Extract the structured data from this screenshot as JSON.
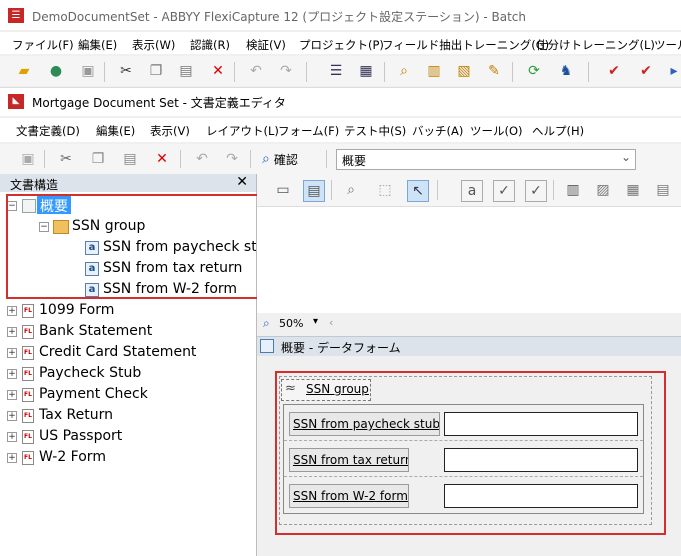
{
  "outer": {
    "title": "DemoDocumentSet - ABBYY FlexiCapture 12 (プロジェクト設定ステーション) - Batch",
    "menu": [
      "ファイル(F)",
      "編集(E)",
      "表示(W)",
      "認識(R)",
      "検証(V)",
      "プロジェクト(P)",
      "フィールド抽出トレーニング(G)",
      "仕分けトレーニング(L)",
      "ツール"
    ]
  },
  "inner": {
    "title": "Mortgage Document Set - 文書定義エディタ",
    "menu": [
      "文書定義(D)",
      "編集(E)",
      "表示(V)",
      "レイアウト(L)",
      "フォーム(F)",
      "テスト中(S)",
      "バッチ(A)",
      "ツール(O)",
      "ヘルプ(H)"
    ],
    "confirm_label": "確認",
    "section_dropdown": "概要"
  },
  "tree": {
    "header": "文書構造",
    "root": "概要",
    "group": "SSN group",
    "fields": [
      "SSN from paycheck stub",
      "SSN from tax return",
      "SSN from W-2 form"
    ],
    "sections": [
      "1099 Form",
      "Bank Statement",
      "Credit Card Statement",
      "Paycheck Stub",
      "Payment Check",
      "Tax Return",
      "US Passport",
      "W-2 Form"
    ]
  },
  "editor": {
    "zoom": "50%",
    "form_title": "概要 - データフォーム",
    "group_label": "SSN group",
    "field_labels": [
      "SSN from paycheck stub",
      "SSN from tax return",
      "SSN from W-2 form"
    ],
    "field_values": [
      "",
      "",
      ""
    ]
  },
  "colors": {
    "highlight": "#d32f2f",
    "selection": "#3399ff",
    "brand": "#c62828"
  },
  "icons": {
    "outer_toolbar": [
      "open-folder-icon",
      "open-icon",
      "save-icon",
      "cut-icon",
      "copy-icon",
      "paste-icon",
      "delete-icon",
      "undo-icon",
      "redo-icon",
      "list-view-icon",
      "grid-view-icon",
      "preview-icon",
      "document-icon",
      "export-icon",
      "edit-icon",
      "refresh-icon",
      "training-icon",
      "check-icon",
      "check-alt-icon"
    ],
    "inner_toolbar": [
      "save-icon",
      "cut-icon",
      "copy-icon",
      "paste-icon",
      "delete-icon",
      "undo-icon",
      "redo-icon",
      "confirm-icon"
    ]
  }
}
